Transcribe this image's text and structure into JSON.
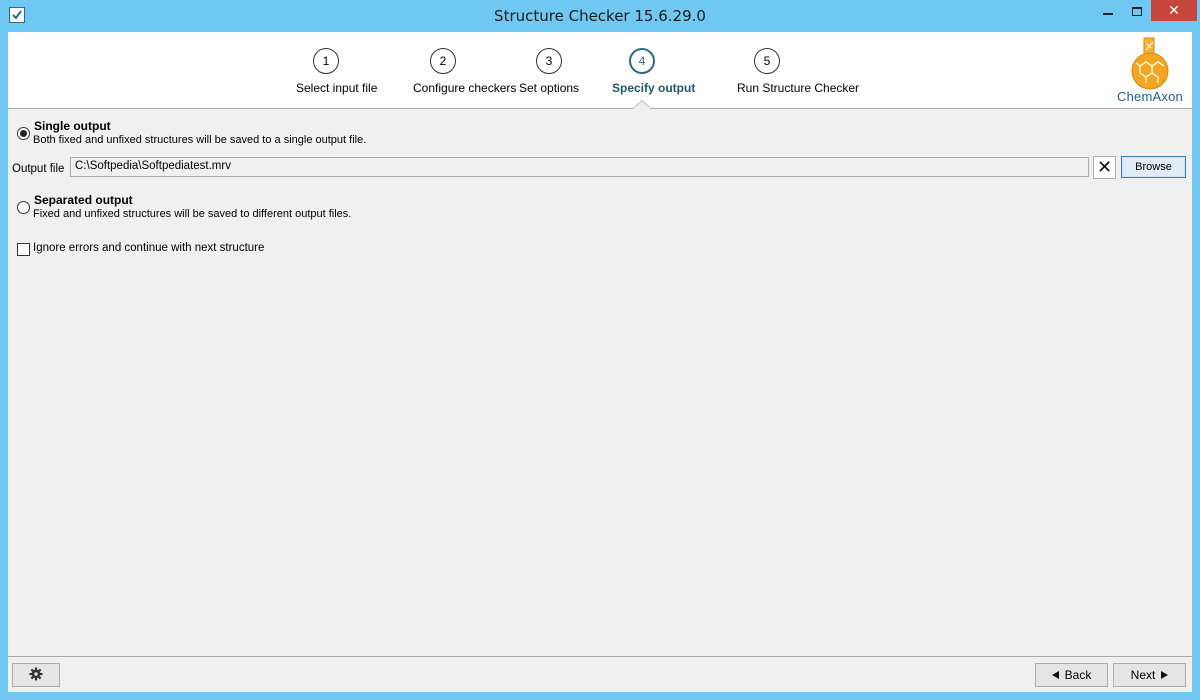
{
  "window": {
    "title": "Structure Checker 15.6.29.0",
    "close_glyph": "✕"
  },
  "wizard": {
    "steps": [
      {
        "number": "1",
        "label": "Select input file"
      },
      {
        "number": "2",
        "label": "Configure checkers"
      },
      {
        "number": "3",
        "label": "Set options"
      },
      {
        "number": "4",
        "label": "Specify output"
      },
      {
        "number": "5",
        "label": "Run Structure Checker"
      }
    ],
    "active_step": 4
  },
  "logo": {
    "text": "ChemAxon",
    "colors": {
      "flask": "#f0a020",
      "text": "#1d5e8a"
    }
  },
  "single_output": {
    "title": "Single output",
    "description": "Both fixed and unfixed structures will be saved to a single output file.",
    "selected": true
  },
  "output_file": {
    "label": "Output file",
    "value": "C:\\Softpedia\\Softpediatest.mrv",
    "clear_glyph": "✕",
    "browse_label": "Browse"
  },
  "separated_output": {
    "title": "Separated output",
    "description": "Fixed and unfixed structures will be saved to different output files.",
    "selected": false
  },
  "ignore_errors": {
    "label": "Ignore errors and continue with next structure",
    "checked": false
  },
  "footer": {
    "settings_icon": "gear-icon",
    "back_label": "Back",
    "next_label": "Next"
  },
  "colors": {
    "titlebar": "#6ec8f2",
    "close": "#c7463b",
    "active_step": "#2e6a7f"
  }
}
